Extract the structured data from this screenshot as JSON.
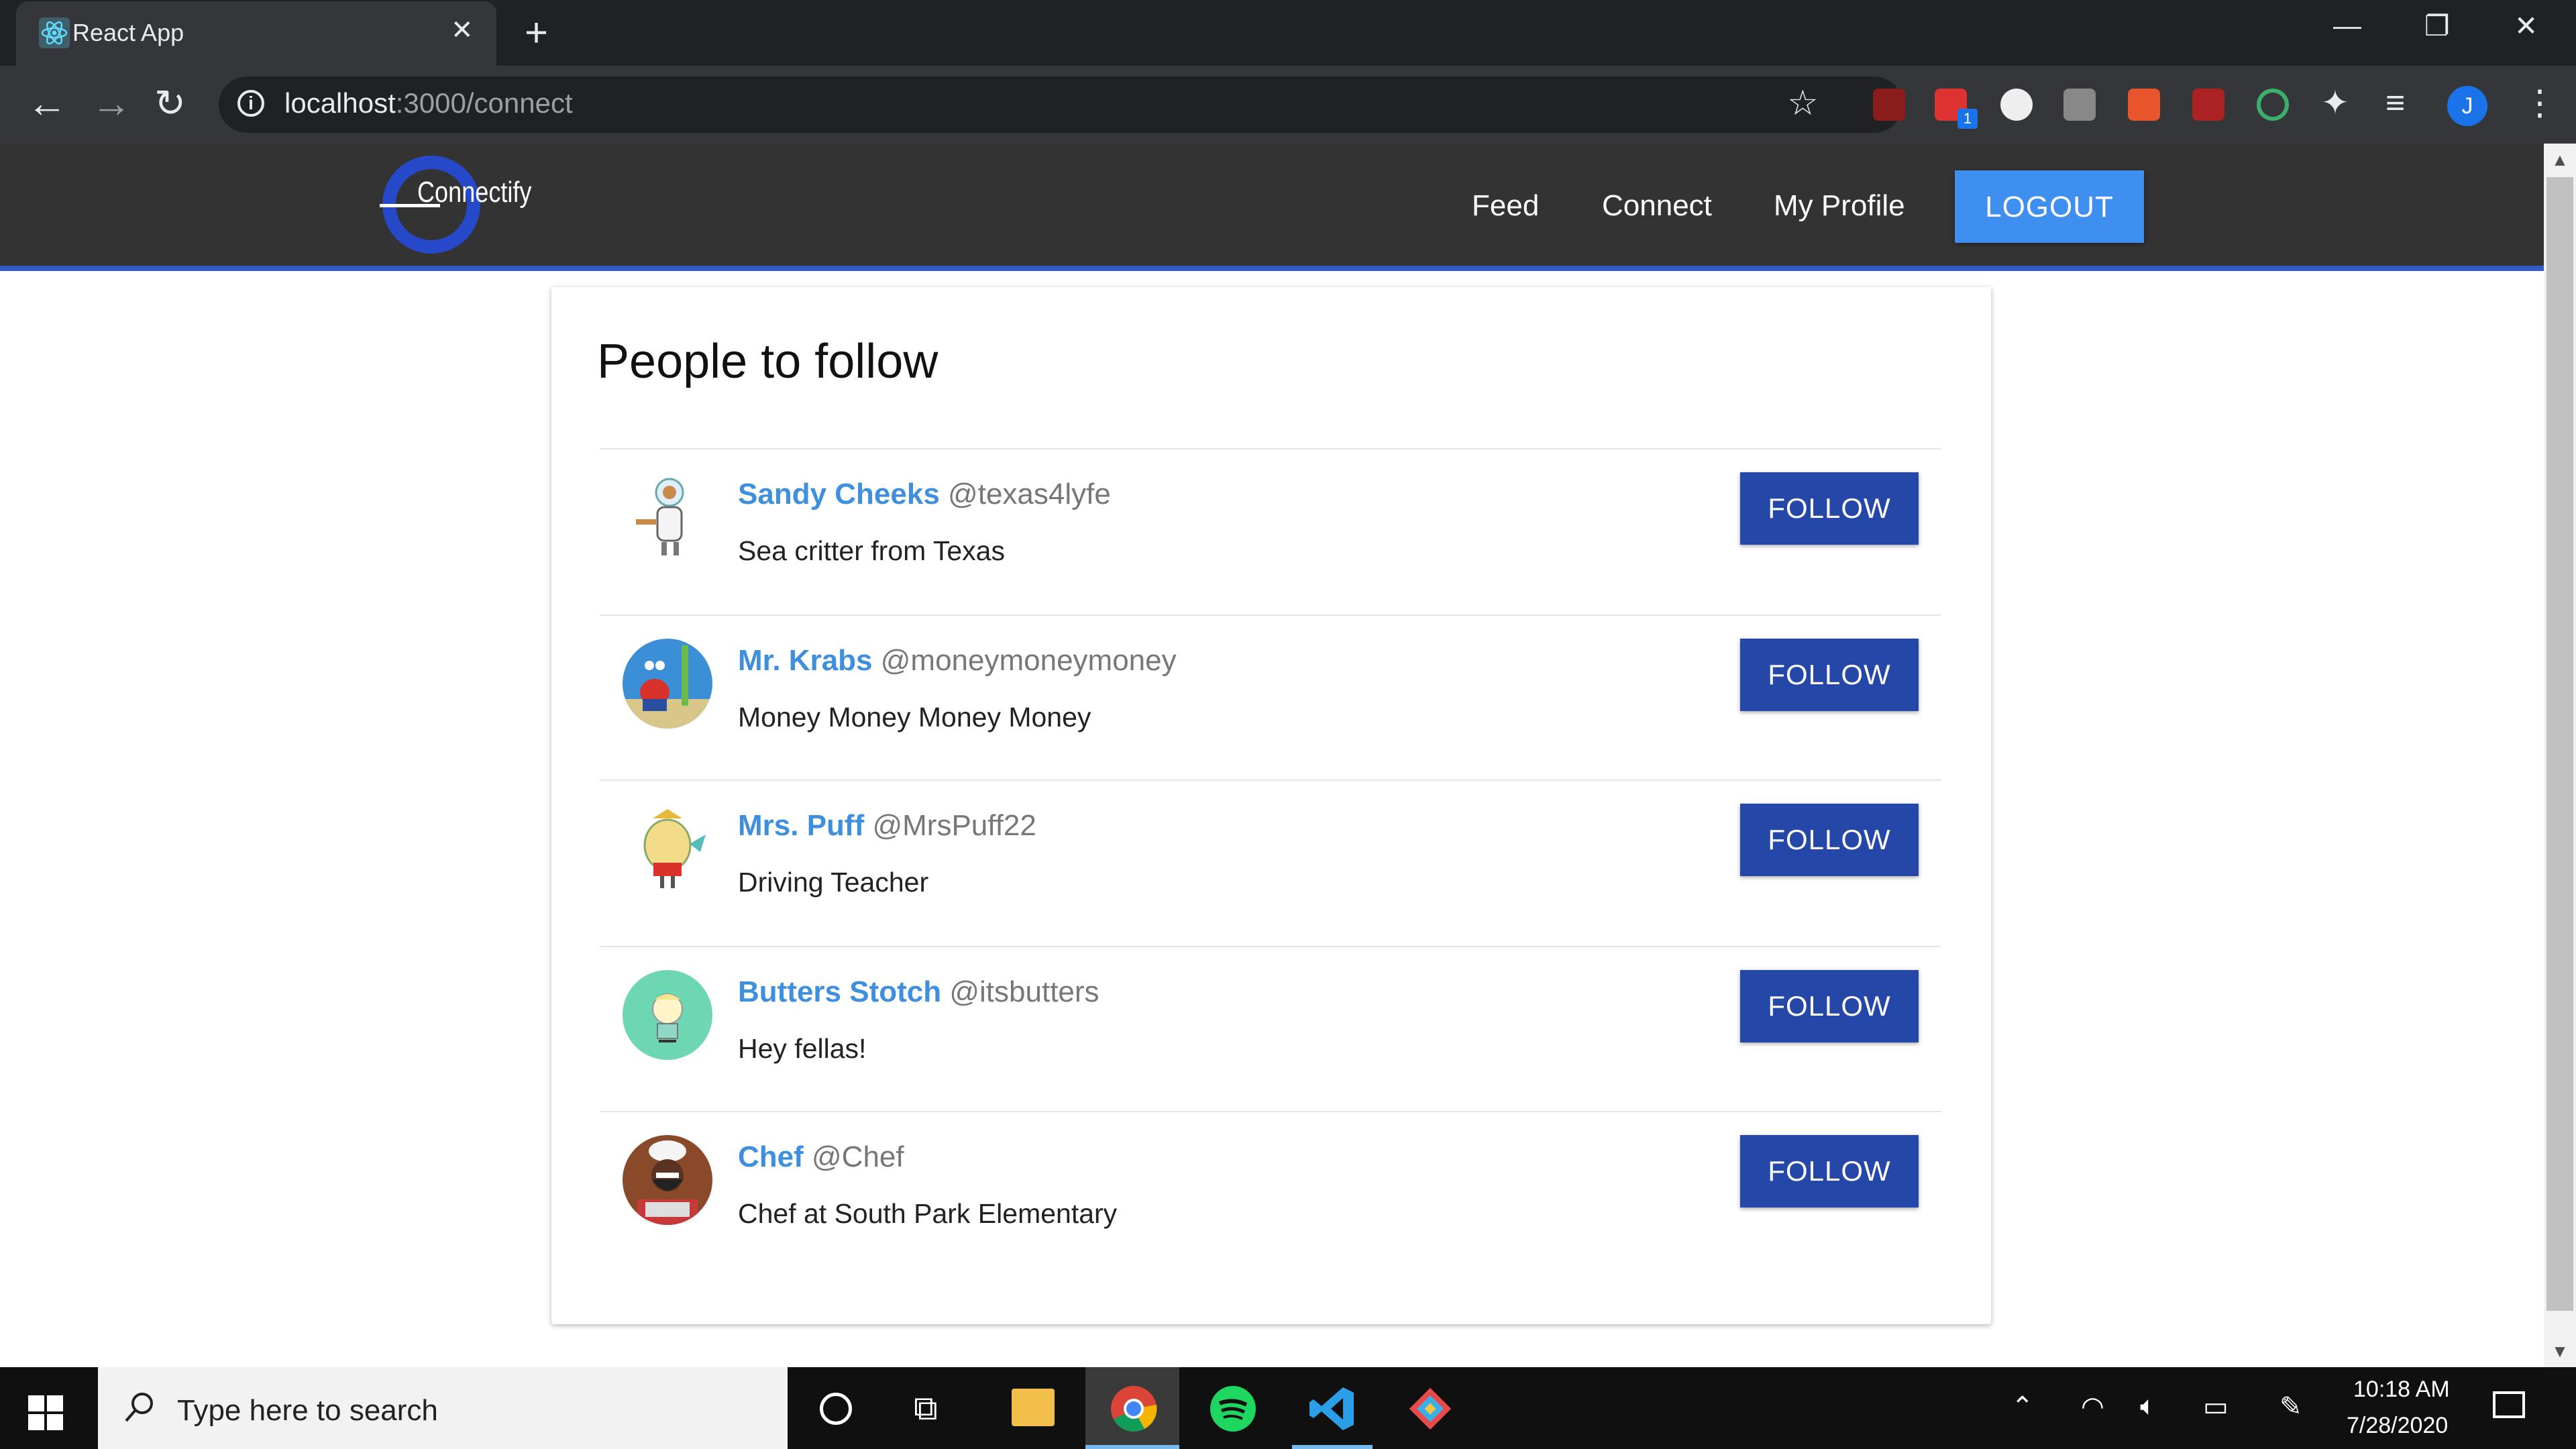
{
  "browser": {
    "tab_title": "React App",
    "url_host": "localhost",
    "url_rest": ":3000/connect",
    "profile_initial": "J",
    "extension_badge": "1"
  },
  "app": {
    "logo_text": "Connectify",
    "nav": [
      "Feed",
      "Connect",
      "My Profile"
    ],
    "logout_label": "LOGOUT"
  },
  "page": {
    "title": "People to follow",
    "follow_label": "FOLLOW",
    "people": [
      {
        "name": "Sandy Cheeks",
        "handle": "@texas4lyfe",
        "bio": "Sea critter from Texas"
      },
      {
        "name": "Mr. Krabs",
        "handle": "@moneymoneymoney",
        "bio": "Money Money Money Money"
      },
      {
        "name": "Mrs. Puff",
        "handle": "@MrsPuff22",
        "bio": "Driving Teacher"
      },
      {
        "name": "Butters Stotch",
        "handle": "@itsbutters",
        "bio": "Hey fellas!"
      },
      {
        "name": "Chef",
        "handle": "@Chef",
        "bio": "Chef at South Park Elementary"
      }
    ]
  },
  "taskbar": {
    "search_placeholder": "Type here to search",
    "time": "10:18 AM",
    "date": "7/28/2020"
  },
  "colors": {
    "accent_blue": "#3f8ff0",
    "follow_blue": "#2548a8",
    "name_blue": "#3f8fdf",
    "header_bg": "#333333"
  }
}
